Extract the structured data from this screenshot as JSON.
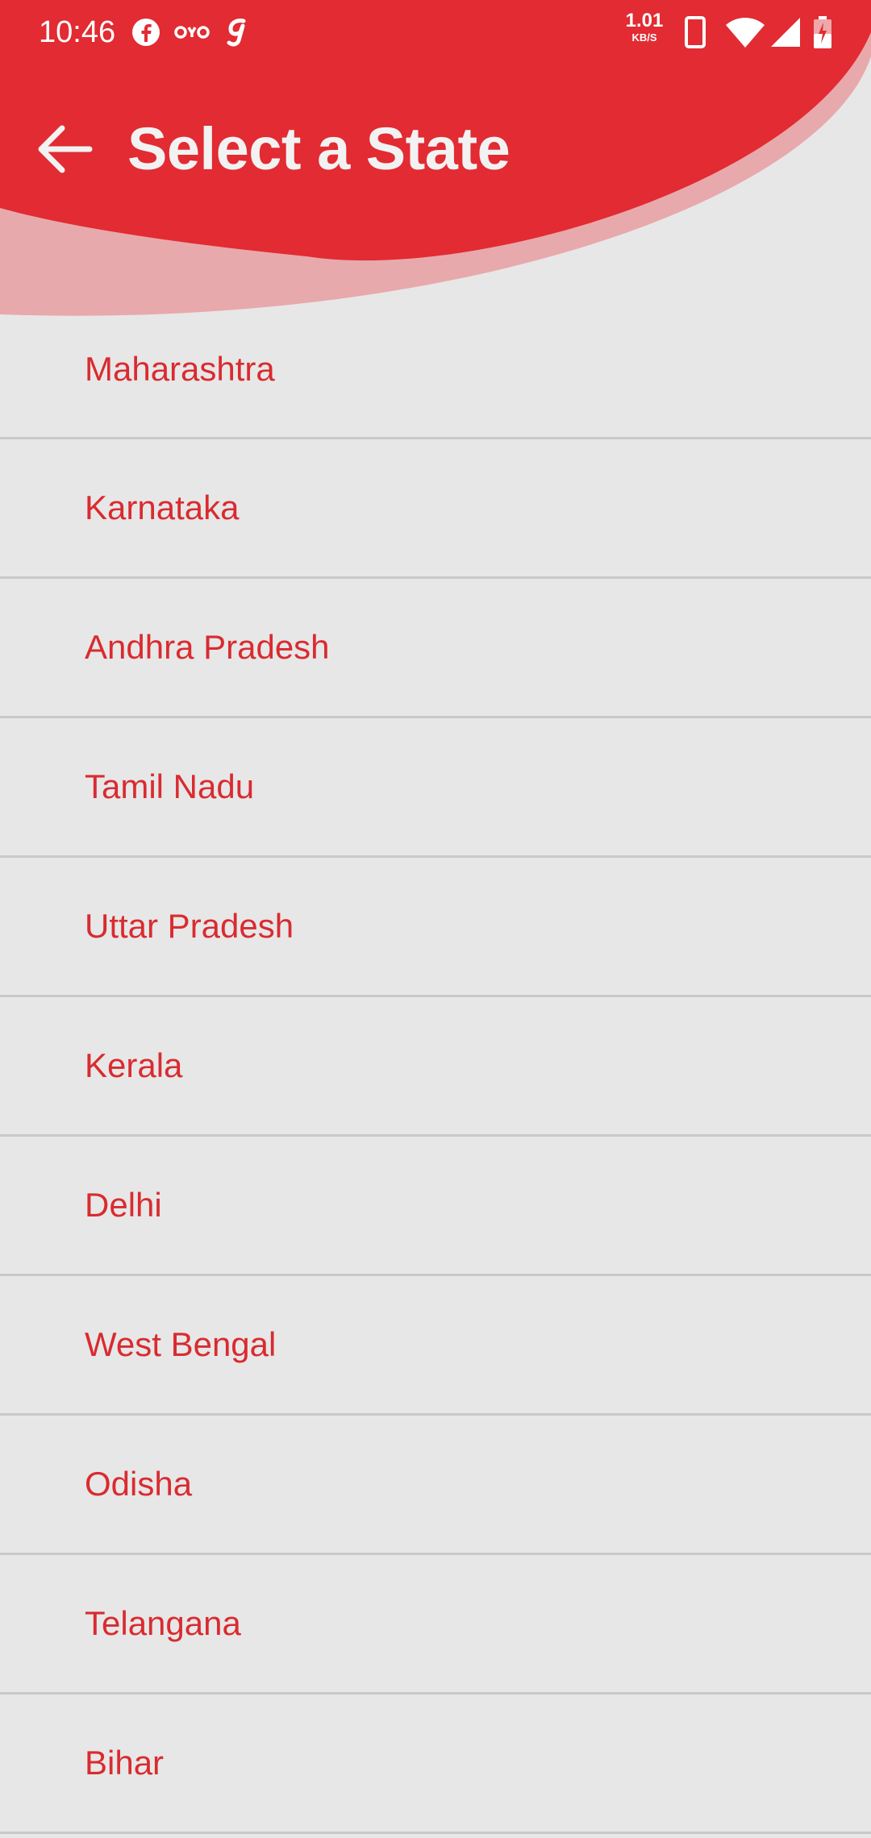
{
  "status_bar": {
    "time": "10:46",
    "speed_value": "1.01",
    "speed_unit": "KB/S",
    "icons": [
      "facebook-icon",
      "oyo-icon",
      "g-icon",
      "phone-icon",
      "wifi-icon",
      "signal-icon",
      "battery-icon"
    ]
  },
  "header": {
    "title": "Select a State",
    "back_icon": "arrow-left-icon"
  },
  "colors": {
    "primary": "#e22b32",
    "primary_light": "#e8a9ac",
    "background": "#e7e7e7",
    "item_text": "#d92b30",
    "divider": "#c9c9c9"
  },
  "states": [
    {
      "label": "Maharashtra"
    },
    {
      "label": "Karnataka"
    },
    {
      "label": "Andhra Pradesh"
    },
    {
      "label": "Tamil Nadu"
    },
    {
      "label": "Uttar Pradesh"
    },
    {
      "label": "Kerala"
    },
    {
      "label": "Delhi"
    },
    {
      "label": "West Bengal"
    },
    {
      "label": "Odisha"
    },
    {
      "label": "Telangana"
    },
    {
      "label": "Bihar"
    }
  ]
}
